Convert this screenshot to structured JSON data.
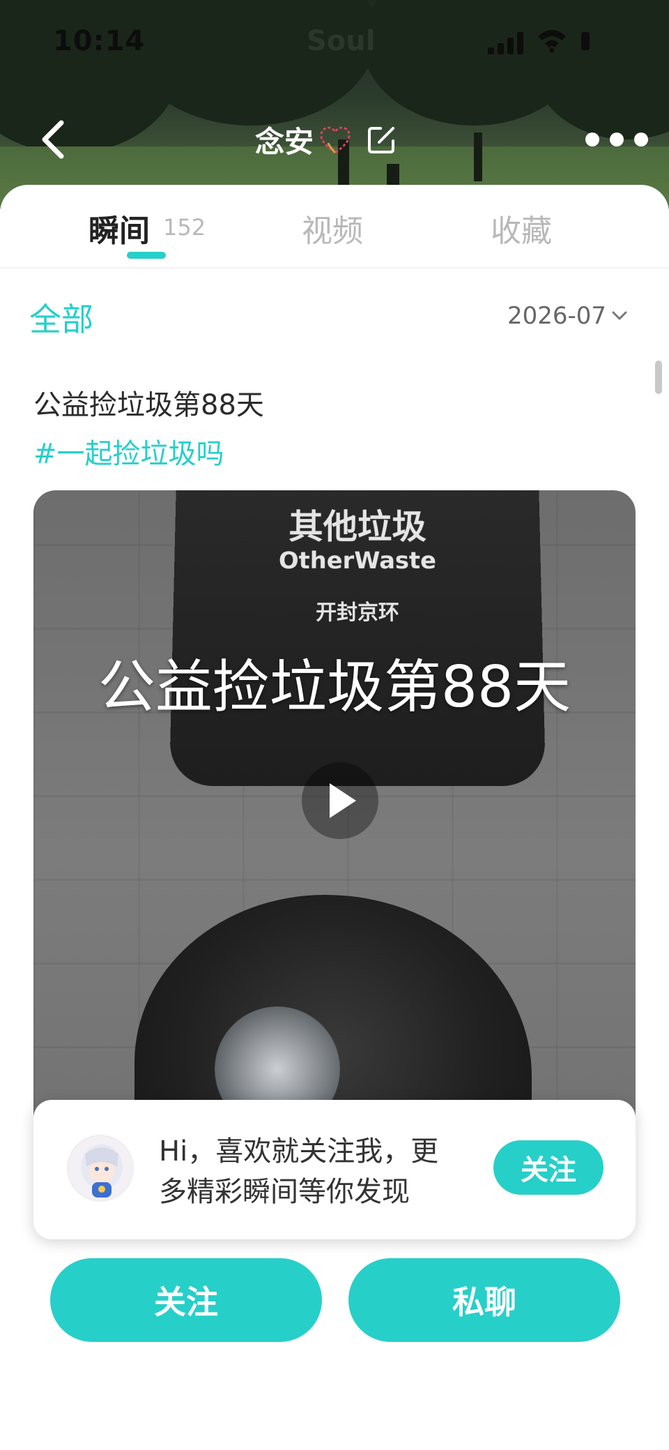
{
  "status_bar": {
    "time": "10:14",
    "app_watermark": "Soul"
  },
  "profile": {
    "name": "念安"
  },
  "tabs": [
    {
      "label": "瞬间",
      "count": "152"
    },
    {
      "label": "视频"
    },
    {
      "label": "收藏"
    }
  ],
  "filter": {
    "scope": "全部",
    "date": "2026-07"
  },
  "post": {
    "text": "公益捡垃圾第88天",
    "tag": "#一起捡垃圾吗",
    "video": {
      "caption": "公益捡垃圾第88天",
      "bin_label_cn": "其他垃圾",
      "bin_label_en": "OtherWaste",
      "bin_brand": "开封京环"
    }
  },
  "follow_prompt": {
    "message_line1": "Hi，喜欢就关注我，更",
    "message_line2": "多精彩瞬间等你发现",
    "button": "关注"
  },
  "actions": {
    "follow": "关注",
    "chat": "私聊"
  },
  "colors": {
    "accent": "#27cfc9"
  }
}
